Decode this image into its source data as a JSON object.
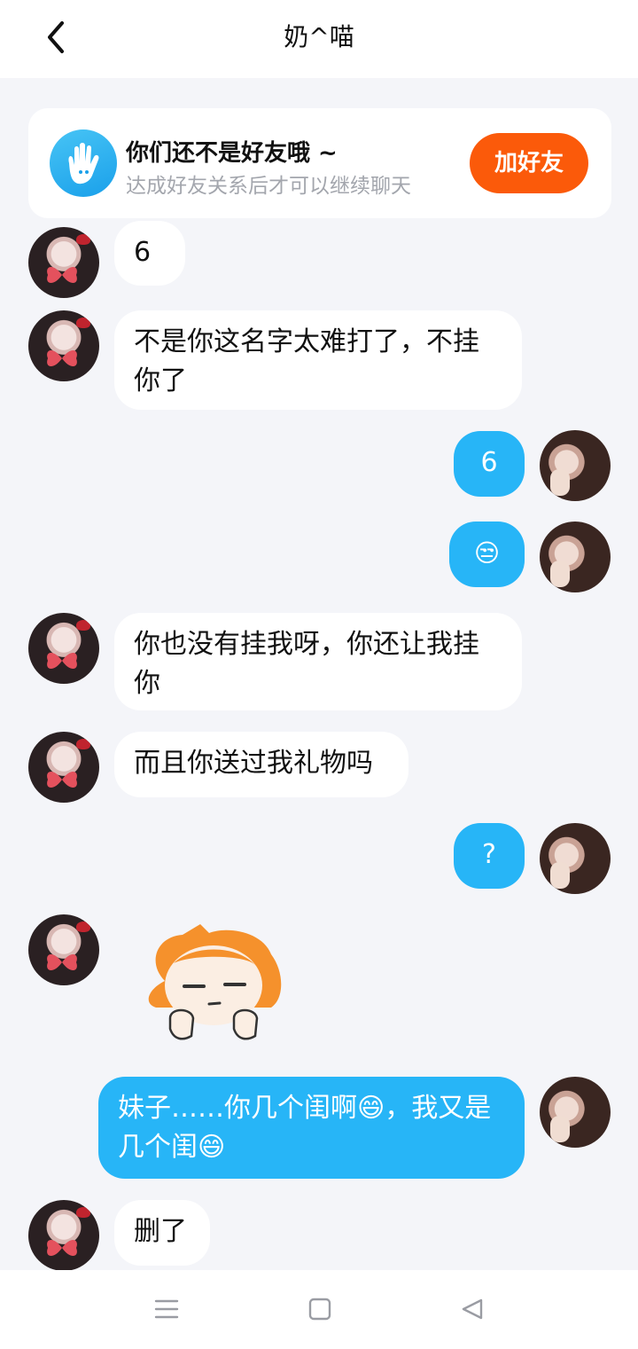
{
  "header": {
    "title": "奶^喵",
    "back_icon": "chevron-left-icon"
  },
  "friend_prompt": {
    "icon": "waving-hand-icon",
    "title": "你们还不是好友哦 ~",
    "subtitle": "达成好友关系后才可以继续聊天",
    "button": "加好友"
  },
  "messages": [
    {
      "sender": "them",
      "text": "6"
    },
    {
      "sender": "them",
      "text": "不是你这名字太难打了，不挂你了"
    },
    {
      "sender": "me",
      "text": "6"
    },
    {
      "sender": "me",
      "emoji": "😒"
    },
    {
      "sender": "them",
      "text": "你也没有挂我呀，你还让我挂你"
    },
    {
      "sender": "them",
      "text": "而且你送过我礼物吗"
    },
    {
      "sender": "me",
      "text": "?"
    },
    {
      "sender": "them",
      "sticker": "unamused-cartoon-girl-sticker"
    },
    {
      "sender": "me",
      "text": "妹子……你几个闺啊😄，我又是几个闺😄"
    },
    {
      "sender": "them",
      "text": "删了"
    }
  ],
  "nav": {
    "menu": "menu-icon",
    "home": "home-icon",
    "back": "back-triangle-icon"
  },
  "colors": {
    "accent_blue": "#27b5f7",
    "add_button": "#fb5a0a",
    "background": "#f4f5f9"
  }
}
